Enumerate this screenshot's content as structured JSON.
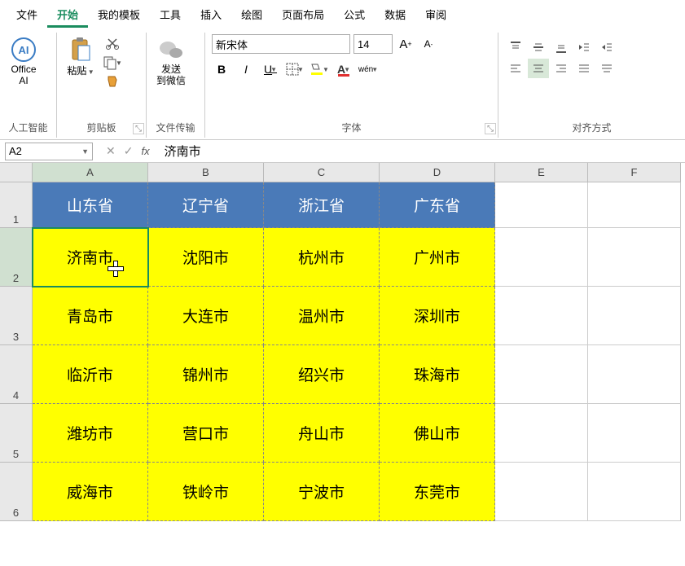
{
  "menu": {
    "items": [
      "文件",
      "开始",
      "我的模板",
      "工具",
      "插入",
      "绘图",
      "页面布局",
      "公式",
      "数据",
      "审阅"
    ],
    "active_index": 1
  },
  "ribbon": {
    "ai": {
      "label": "Office\nAI",
      "group": "人工智能"
    },
    "clipboard": {
      "paste": "粘贴",
      "group": "剪贴板"
    },
    "wechat": {
      "label": "发送\n到微信",
      "group": "文件传输"
    },
    "font": {
      "name": "新宋体",
      "size": "14",
      "group": "字体",
      "bold": "B",
      "italic": "I",
      "underline": "U",
      "pinyin": "wén"
    },
    "align": {
      "group": "对齐方式"
    }
  },
  "name_box": "A2",
  "formula": "济南市",
  "columns": [
    "A",
    "B",
    "C",
    "D",
    "E",
    "F"
  ],
  "rows": [
    "1",
    "2",
    "3",
    "4",
    "5",
    "6"
  ],
  "table": {
    "headers": [
      "山东省",
      "辽宁省",
      "浙江省",
      "广东省"
    ],
    "data": [
      [
        "济南市",
        "沈阳市",
        "杭州市",
        "广州市"
      ],
      [
        "青岛市",
        "大连市",
        "温州市",
        "深圳市"
      ],
      [
        "临沂市",
        "锦州市",
        "绍兴市",
        "珠海市"
      ],
      [
        "潍坊市",
        "营口市",
        "舟山市",
        "佛山市"
      ],
      [
        "威海市",
        "铁岭市",
        "宁波市",
        "东莞市"
      ]
    ]
  },
  "active_cell": {
    "row": 2,
    "col": "A"
  }
}
